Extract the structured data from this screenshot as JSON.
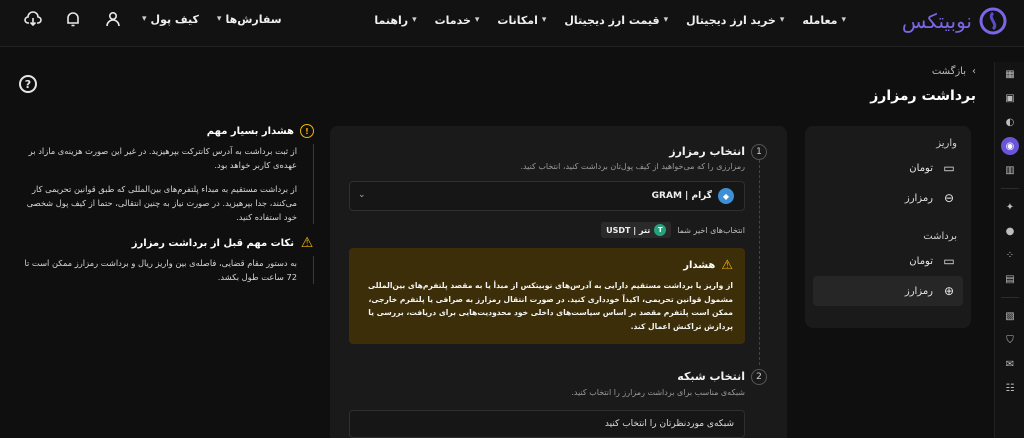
{
  "brand": {
    "name": "نوبیتکس",
    "accent": "#7a66e8"
  },
  "nav": {
    "items": [
      {
        "label": "معامله"
      },
      {
        "label": "خرید ارز دیجیتال"
      },
      {
        "label": "قیمت ارز دیجیتال"
      },
      {
        "label": "امکانات"
      },
      {
        "label": "خدمات"
      },
      {
        "label": "راهنما"
      }
    ],
    "orders_label": "سفارش‌ها",
    "wallet_label": "کیف پول"
  },
  "breadcrumb": {
    "back_label": "بازگشت"
  },
  "page": {
    "title": "برداشت رمزارز"
  },
  "sidebar": {
    "deposit_group": "واریز",
    "withdraw_group": "برداشت",
    "items": [
      {
        "label": "تومان",
        "icon": "bank-icon"
      },
      {
        "label": "رمزارز",
        "icon": "download-icon"
      },
      {
        "label": "تومان",
        "icon": "bank-icon"
      },
      {
        "label": "رمزارز",
        "icon": "upload-icon"
      }
    ]
  },
  "step1": {
    "number": "1",
    "title": "انتخاب رمزارز",
    "subtitle": "رمزارزی را که می‌خواهید از کیف پول‌تان برداشت کنید، انتخاب کنید.",
    "selected": "گرام | GRAM",
    "recent_label": "انتخاب‌های اخیر شما",
    "recent_chip": "تتر | USDT"
  },
  "warning": {
    "title": "هشدار",
    "body": "از واریز یا برداشت مستقیم دارایی به آدرس‌های نوبیتکس از مبدأ یا به مقصد پلتفرم‌های بین‌المللی مشمول قوانین تحریمی، اکیداً خودداری کنید. در صورت انتقال رمزارز به صرافی یا پلتفرم خارجی، ممکن است پلتفرم مقصد بر اساس سیاست‌های داخلی خود محدودیت‌هایی برای دریافت، بررسی یا پردازش تراکنش اعمال کند."
  },
  "step2": {
    "number": "2",
    "title": "انتخاب شبکه",
    "subtitle": "شبکه‌ی مناسب برای برداشت رمزارز را انتخاب کنید.",
    "placeholder": "شبکه‌ی موردنظرتان را انتخاب کنید"
  },
  "notes": {
    "important": {
      "title": "هشدار بسیار مهم",
      "p1": "از ثبت برداشت به آدرس کانترکت بپرهیزید. در غیر این صورت هزینه‌ی مازاد بر عهده‌ی کاربر خواهد بود.",
      "p2": "از برداشت مستقیم به مبداء پلتفرم‌های بین‌المللی که طبق قوانین تحریمی کار می‌کنند، جدا بپرهیزید. در صورت نیاز به چنین انتقالی، حتما از کیف پول شخصی خود استفاده کنید."
    },
    "tips": {
      "title": "نکات مهم قبل از برداشت رمزارز",
      "p1": "به دستور مقام قضایی، فاصله‌ی بین واریز ریال و برداشت رمزارز ممکن است تا 72 ساعت طول بکشد."
    }
  },
  "colors": {
    "warning_bg": "#3d2e0a",
    "warning_icon": "#f5b400",
    "panel_bg": "#1a1a1a",
    "page_bg": "#0f0f0f"
  }
}
